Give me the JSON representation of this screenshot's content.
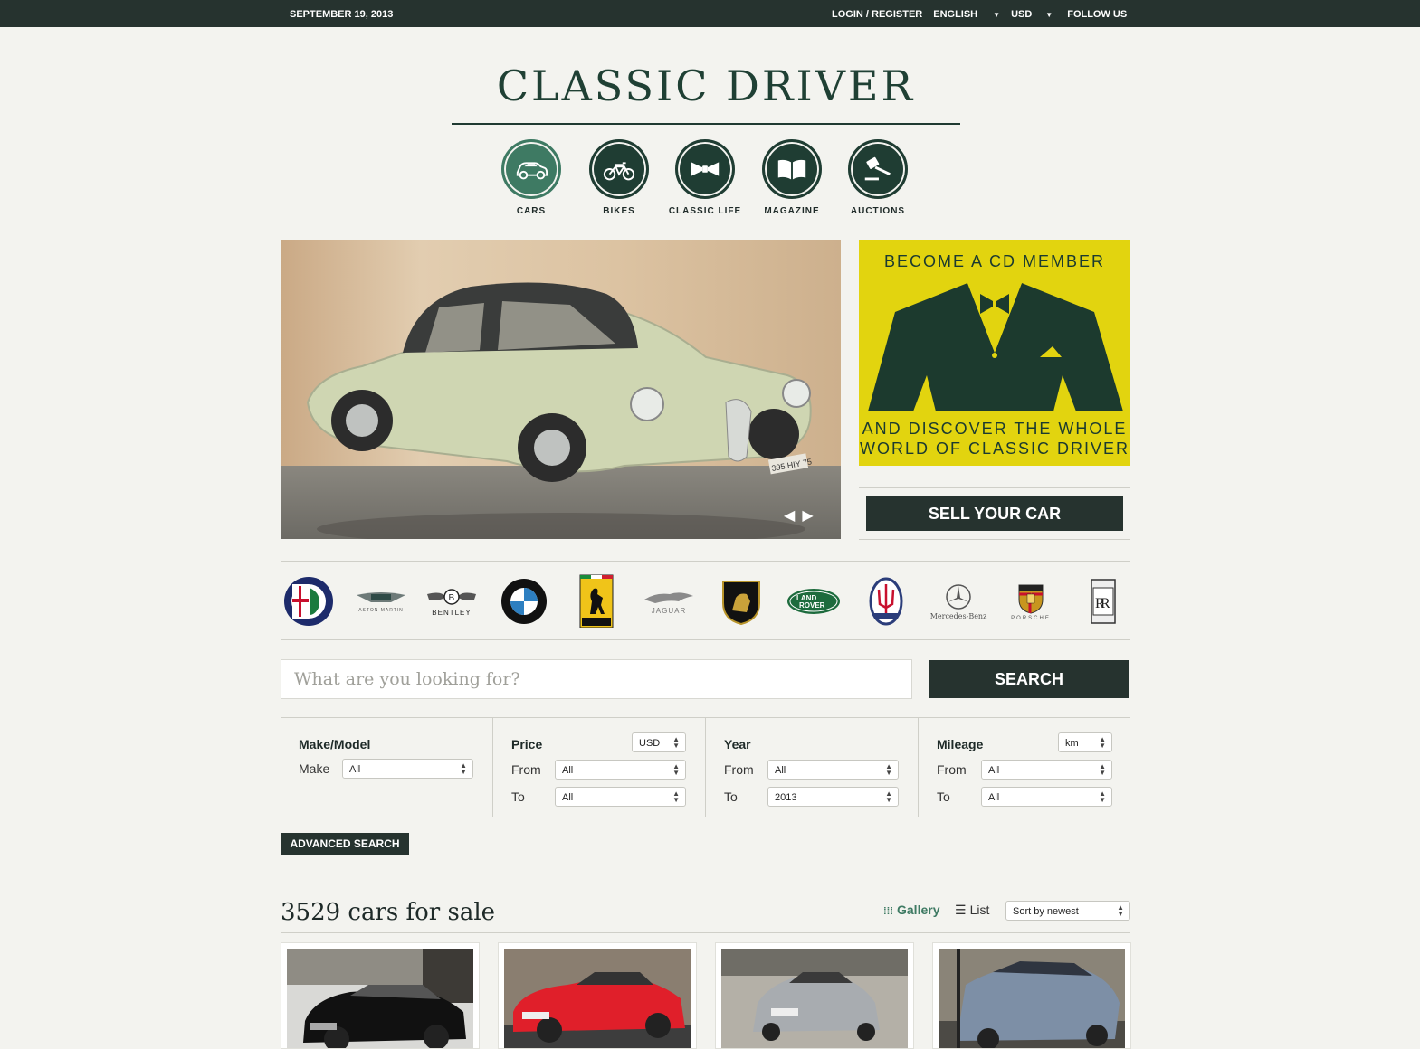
{
  "topbar": {
    "date": "SEPTEMBER 19, 2013",
    "login": "LOGIN / REGISTER",
    "language": "ENGLISH",
    "currency": "USD",
    "follow": "FOLLOW US"
  },
  "logo": "CLASSIC DRIVER",
  "nav": [
    {
      "label": "CARS",
      "icon": "car-icon",
      "active": true
    },
    {
      "label": "BIKES",
      "icon": "motorbike-icon"
    },
    {
      "label": "CLASSIC LIFE",
      "icon": "bowtie-icon"
    },
    {
      "label": "MAGAZINE",
      "icon": "book-icon"
    },
    {
      "label": "AUCTIONS",
      "icon": "gavel-icon"
    }
  ],
  "hero": {
    "plate": "395 HIY 75"
  },
  "member_ad": {
    "line1": "BECOME A CD MEMBER",
    "line2": "AND DISCOVER THE WHOLE",
    "line3": "WORLD OF CLASSIC DRIVER"
  },
  "sell_button": "SELL YOUR CAR",
  "brands": [
    {
      "name": "Alfa Romeo",
      "caption": ""
    },
    {
      "name": "Aston Martin",
      "caption": "ASTON MARTIN"
    },
    {
      "name": "Bentley",
      "caption": "BENTLEY"
    },
    {
      "name": "BMW",
      "caption": ""
    },
    {
      "name": "Ferrari",
      "caption": "Ferrari"
    },
    {
      "name": "Jaguar",
      "caption": "JAGUAR"
    },
    {
      "name": "Lamborghini",
      "caption": ""
    },
    {
      "name": "Land Rover",
      "caption": "LAND ROVER"
    },
    {
      "name": "Maserati",
      "caption": ""
    },
    {
      "name": "Mercedes-Benz",
      "caption": "Mercedes-Benz"
    },
    {
      "name": "Porsche",
      "caption": "PORSCHE"
    },
    {
      "name": "Rolls-Royce",
      "caption": "ROLLS ROYCE"
    }
  ],
  "search": {
    "placeholder": "What are you looking for?",
    "button": "SEARCH"
  },
  "filters": {
    "make_model": {
      "title": "Make/Model",
      "make_label": "Make",
      "make_value": "All"
    },
    "price": {
      "title": "Price",
      "currency": "USD",
      "from_label": "From",
      "from_value": "All",
      "to_label": "To",
      "to_value": "All"
    },
    "year": {
      "title": "Year",
      "from_label": "From",
      "from_value": "All",
      "to_label": "To",
      "to_value": "2013"
    },
    "mileage": {
      "title": "Mileage",
      "unit": "km",
      "from_label": "From",
      "from_value": "All",
      "to_label": "To",
      "to_value": "All"
    }
  },
  "advanced_search": "ADVANCED SEARCH",
  "listing": {
    "count_text": "3529 cars for sale",
    "gallery_label": "Gallery",
    "list_label": "List",
    "sort_value": "Sort by newest"
  },
  "colors": {
    "dark": "#26332f",
    "green": "#3e7a63",
    "yellow": "#e2d40f",
    "bg": "#f3f3ef"
  }
}
